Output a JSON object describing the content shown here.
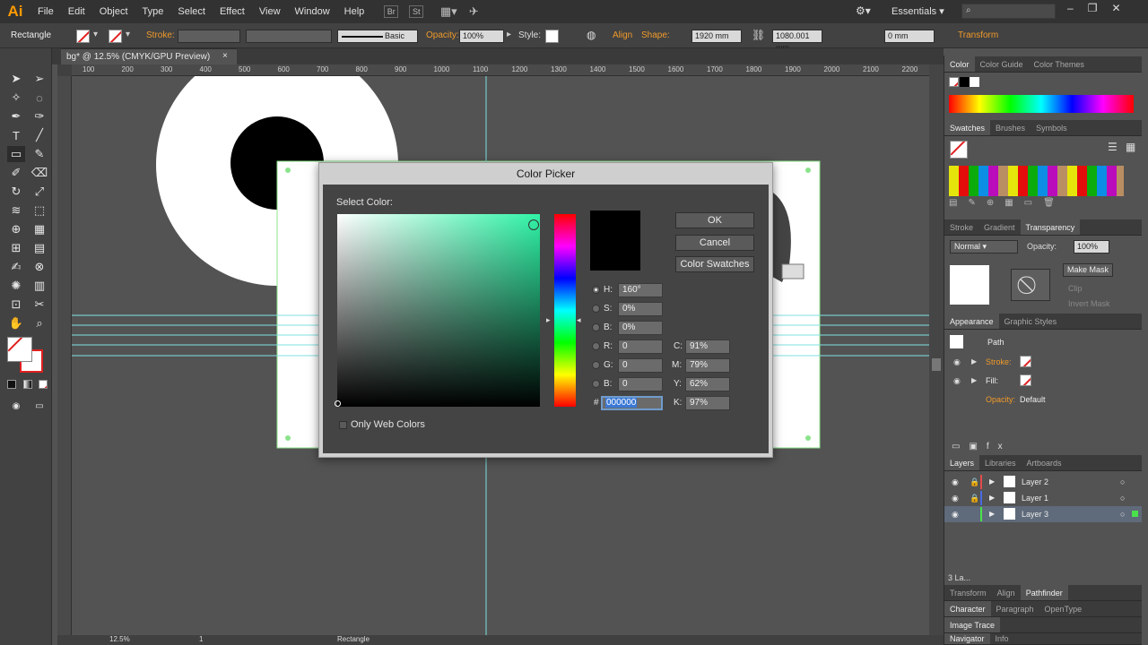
{
  "app": {
    "logo": "Ai"
  },
  "menu": [
    "File",
    "Edit",
    "Object",
    "Type",
    "Select",
    "Effect",
    "View",
    "Window",
    "Help"
  ],
  "menubar_icons": [
    "Br",
    "St"
  ],
  "workspace": "Essentials",
  "control_bar": {
    "object_type": "Rectangle",
    "stroke_label": "Stroke:",
    "brush_style": "Basic",
    "opacity_label": "Opacity:",
    "opacity_value": "100%",
    "style_label": "Style:",
    "align_label": "Align",
    "shape_label": "Shape:",
    "width_value": "1920 mm",
    "height_value": "1080.001 mm",
    "corner_value": "0 mm",
    "transform_label": "Transform"
  },
  "document_tab": {
    "title": "bg* @ 12.5% (CMYK/GPU Preview)",
    "close": "×"
  },
  "ruler_marks": [
    "100",
    "200",
    "300",
    "400",
    "500",
    "600",
    "700",
    "800",
    "900",
    "1000",
    "1100",
    "1200",
    "1300",
    "1400",
    "1500",
    "1600",
    "1700",
    "1800",
    "1900",
    "2000",
    "2100",
    "2200"
  ],
  "color_picker": {
    "title": "Color Picker",
    "select_label": "Select Color:",
    "ok": "OK",
    "cancel": "Cancel",
    "swatches": "Color Swatches",
    "only_web": "Only Web Colors",
    "hue_color": "#2ff3a6",
    "fields": {
      "H": "160°",
      "S": "0%",
      "B": "0%",
      "R": "0",
      "G": "0",
      "B2": "0",
      "hex": "000000",
      "C": "91%",
      "M": "79%",
      "Y": "62%",
      "K": "97%"
    },
    "field_labels": {
      "H": "H:",
      "S": "S:",
      "B": "B:",
      "R": "R:",
      "G": "G:",
      "B2": "B:",
      "hex": "#",
      "C": "C:",
      "M": "M:",
      "Y": "Y:",
      "K": "K:"
    }
  },
  "panels": {
    "color_tabs": [
      "Color",
      "Color Guide",
      "Color Themes"
    ],
    "swatch_tabs": [
      "Swatches",
      "Brushes",
      "Symbols"
    ],
    "transparency_tabs": [
      "Stroke",
      "Gradient",
      "Transparency"
    ],
    "blend_mode": "Normal",
    "opacity_label": "Opacity:",
    "opacity_value": "100%",
    "make_mask": "Make Mask",
    "clip": "Clip",
    "invert_mask": "Invert Mask",
    "appearance_tabs": [
      "Appearance",
      "Graphic Styles"
    ],
    "appearance_path": "Path",
    "appearance_stroke": "Stroke:",
    "appearance_fill": "Fill:",
    "appearance_opacity": "Opacity:",
    "appearance_opacity_value": "Default",
    "layers_tabs": [
      "Layers",
      "Libraries",
      "Artboards"
    ],
    "layers": [
      "Layer 2",
      "Layer 1",
      "Layer 3"
    ],
    "layers_count": "3 La...",
    "bottom_tabs": [
      "Transform",
      "Align",
      "Pathfinder"
    ],
    "char_tabs": [
      "Character",
      "Paragraph",
      "OpenType"
    ],
    "image_trace": "Image Trace",
    "nav_tabs": [
      "Navigator",
      "Info"
    ]
  },
  "status": {
    "zoom": "12.5%",
    "artboard": "1",
    "tool": "Rectangle"
  }
}
